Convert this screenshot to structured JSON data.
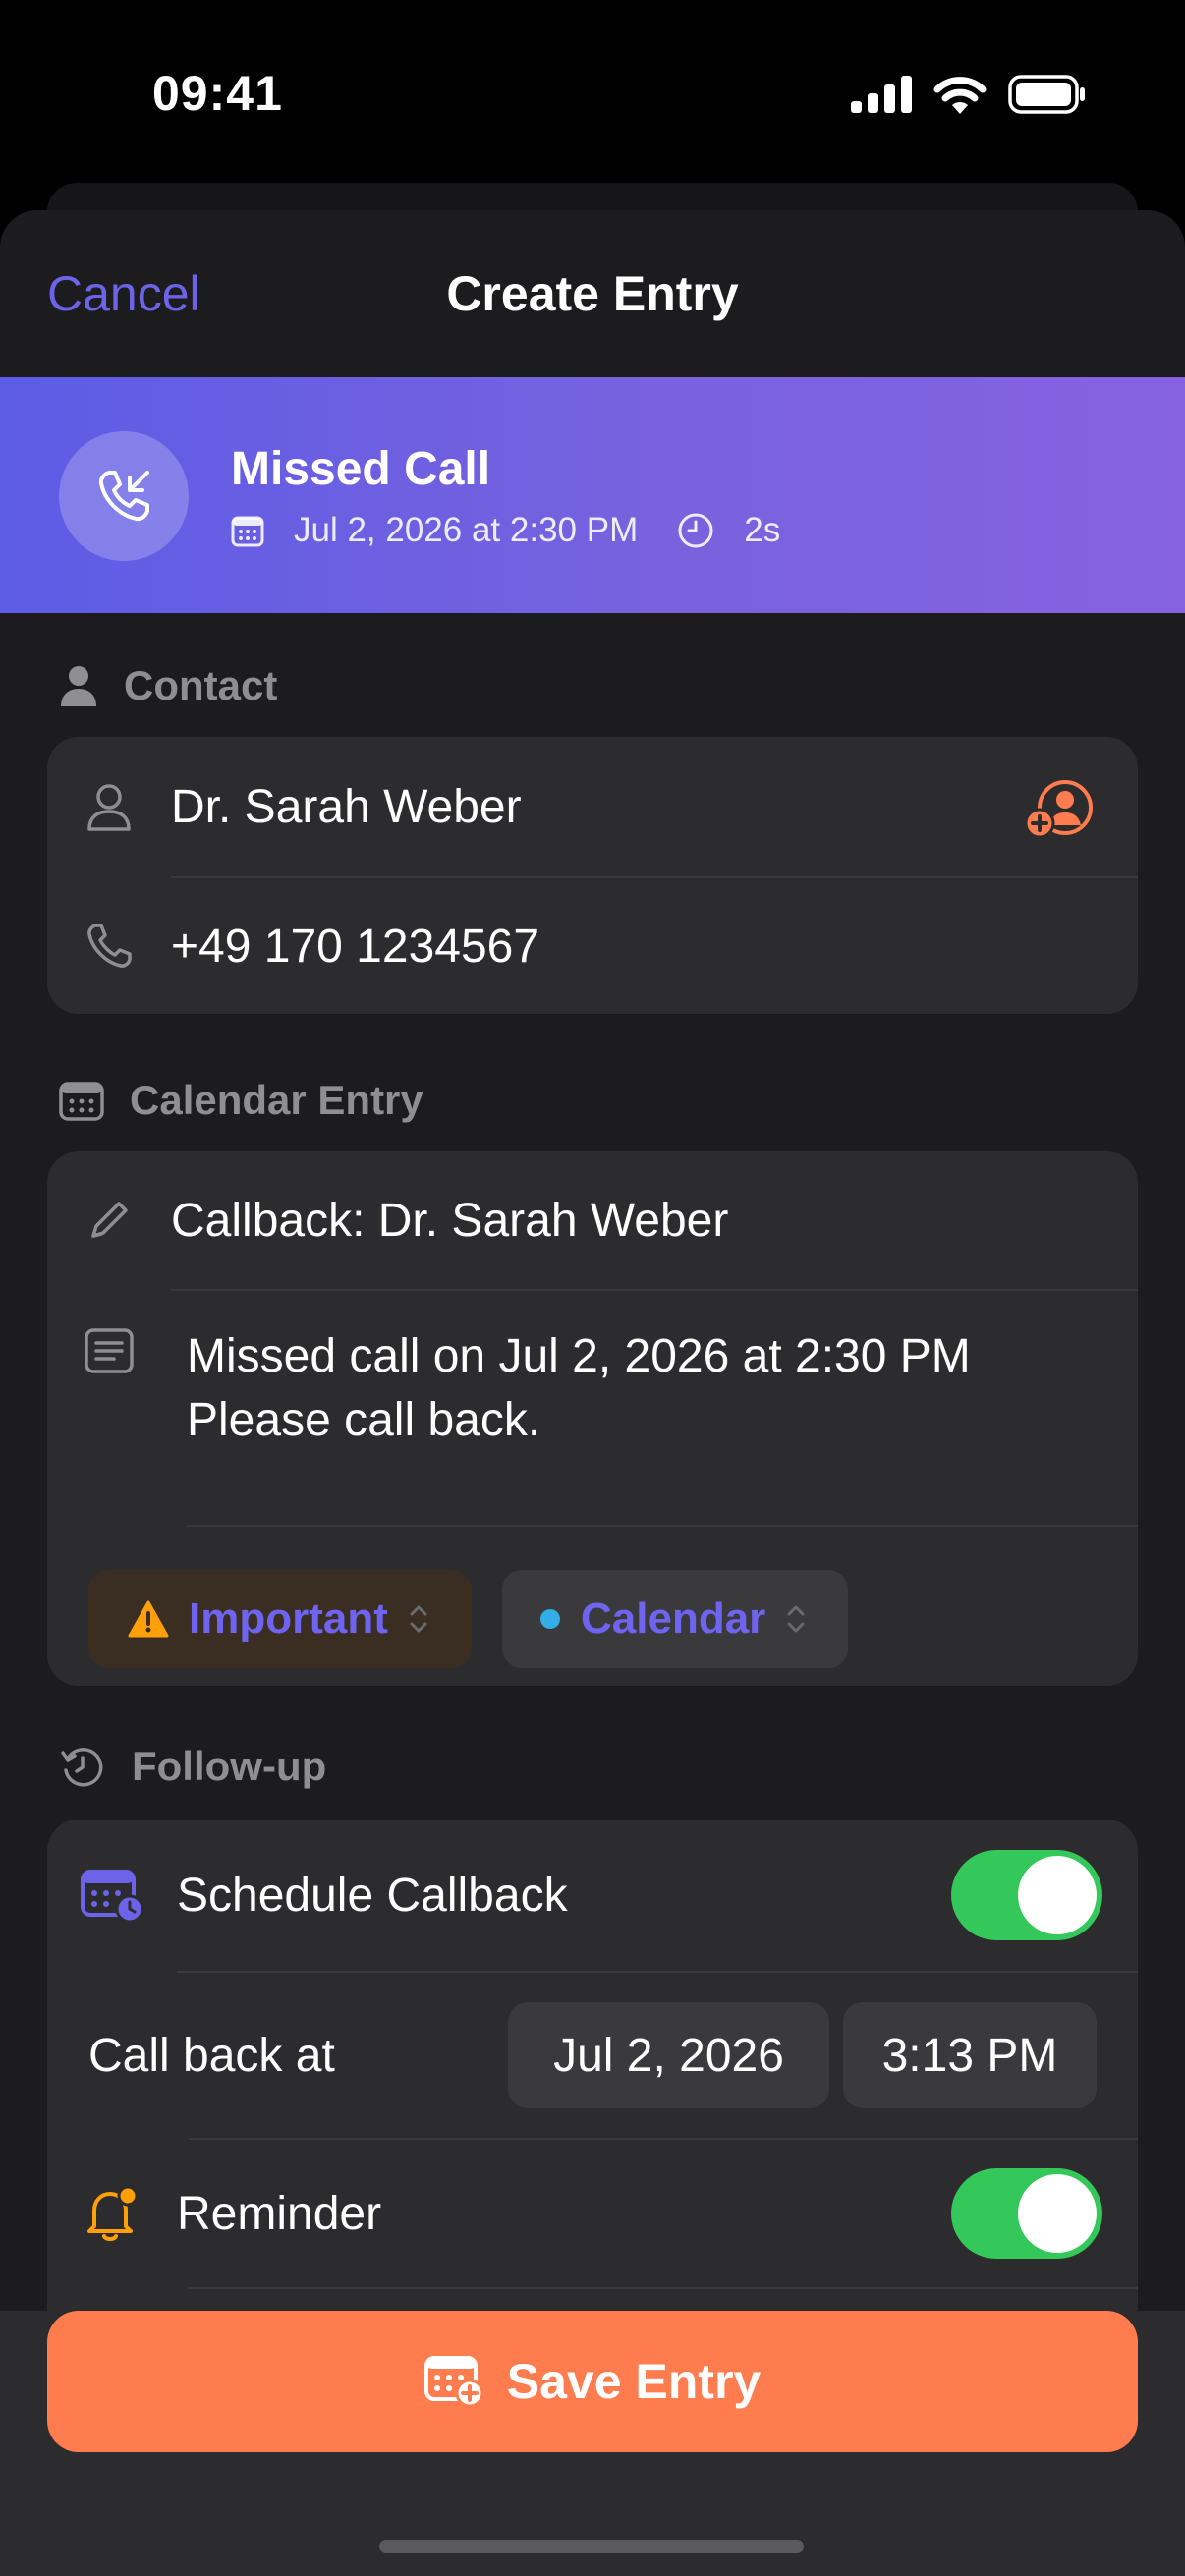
{
  "status_bar": {
    "time": "09:41"
  },
  "nav": {
    "cancel_label": "Cancel",
    "title": "Create Entry"
  },
  "call_banner": {
    "title": "Missed Call",
    "datetime": "Jul 2, 2026 at 2:30 PM",
    "duration": "2s"
  },
  "contact": {
    "section_title": "Contact",
    "name": "Dr. Sarah Weber",
    "phone": "+49 170 1234567"
  },
  "calendar_entry": {
    "section_title": "Calendar Entry",
    "title_value": "Callback: Dr. Sarah Weber",
    "notes_line1": "Missed call on Jul 2, 2026 at 2:30 PM",
    "notes_line2": "Please call back.",
    "priority_label": "Important",
    "calendar_label": "Calendar"
  },
  "follow_up": {
    "section_title": "Follow-up",
    "schedule_label": "Schedule Callback",
    "schedule_enabled": true,
    "callback_at_label": "Call back at",
    "callback_date": "Jul 2, 2026",
    "callback_time": "3:13 PM",
    "reminder_label": "Reminder",
    "reminder_enabled": true
  },
  "actions": {
    "save_label": "Save Entry"
  },
  "colors": {
    "accent": "#6c63e8",
    "save_button": "#ff7c4f",
    "toggle_on": "#34c759",
    "warning": "#ff9f0a",
    "calendar_dot": "#32ade6"
  }
}
